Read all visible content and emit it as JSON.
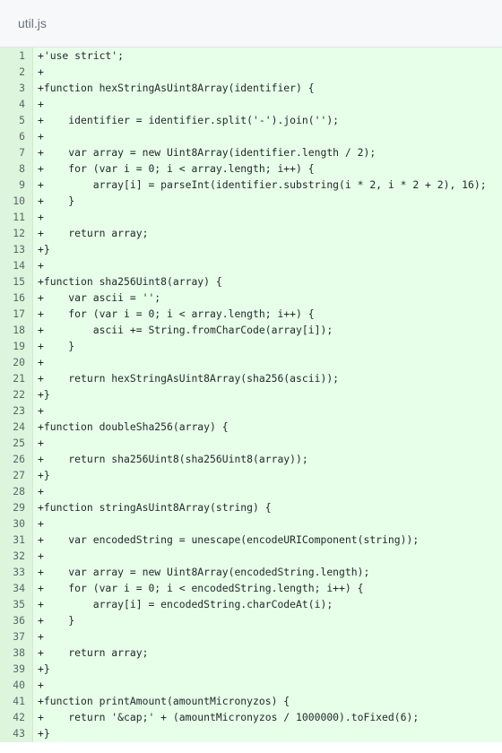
{
  "file": {
    "name": "util.js"
  },
  "diff": {
    "lines": [
      {
        "num": "1",
        "code": "+'use strict';"
      },
      {
        "num": "2",
        "code": "+"
      },
      {
        "num": "3",
        "code": "+function hexStringAsUint8Array(identifier) {"
      },
      {
        "num": "4",
        "code": "+"
      },
      {
        "num": "5",
        "code": "+    identifier = identifier.split('-').join('');"
      },
      {
        "num": "6",
        "code": "+"
      },
      {
        "num": "7",
        "code": "+    var array = new Uint8Array(identifier.length / 2);"
      },
      {
        "num": "8",
        "code": "+    for (var i = 0; i < array.length; i++) {"
      },
      {
        "num": "9",
        "code": "+        array[i] = parseInt(identifier.substring(i * 2, i * 2 + 2), 16);"
      },
      {
        "num": "10",
        "code": "+    }"
      },
      {
        "num": "11",
        "code": "+"
      },
      {
        "num": "12",
        "code": "+    return array;"
      },
      {
        "num": "13",
        "code": "+}"
      },
      {
        "num": "14",
        "code": "+"
      },
      {
        "num": "15",
        "code": "+function sha256Uint8(array) {"
      },
      {
        "num": "16",
        "code": "+    var ascii = '';"
      },
      {
        "num": "17",
        "code": "+    for (var i = 0; i < array.length; i++) {"
      },
      {
        "num": "18",
        "code": "+        ascii += String.fromCharCode(array[i]);"
      },
      {
        "num": "19",
        "code": "+    }"
      },
      {
        "num": "20",
        "code": "+"
      },
      {
        "num": "21",
        "code": "+    return hexStringAsUint8Array(sha256(ascii));"
      },
      {
        "num": "22",
        "code": "+}"
      },
      {
        "num": "23",
        "code": "+"
      },
      {
        "num": "24",
        "code": "+function doubleSha256(array) {"
      },
      {
        "num": "25",
        "code": "+"
      },
      {
        "num": "26",
        "code": "+    return sha256Uint8(sha256Uint8(array));"
      },
      {
        "num": "27",
        "code": "+}"
      },
      {
        "num": "28",
        "code": "+"
      },
      {
        "num": "29",
        "code": "+function stringAsUint8Array(string) {"
      },
      {
        "num": "30",
        "code": "+"
      },
      {
        "num": "31",
        "code": "+    var encodedString = unescape(encodeURIComponent(string));"
      },
      {
        "num": "32",
        "code": "+"
      },
      {
        "num": "33",
        "code": "+    var array = new Uint8Array(encodedString.length);"
      },
      {
        "num": "34",
        "code": "+    for (var i = 0; i < encodedString.length; i++) {"
      },
      {
        "num": "35",
        "code": "+        array[i] = encodedString.charCodeAt(i);"
      },
      {
        "num": "36",
        "code": "+    }"
      },
      {
        "num": "37",
        "code": "+"
      },
      {
        "num": "38",
        "code": "+    return array;"
      },
      {
        "num": "39",
        "code": "+}"
      },
      {
        "num": "40",
        "code": "+"
      },
      {
        "num": "41",
        "code": "+function printAmount(amountMicronyzos) {"
      },
      {
        "num": "42",
        "code": "+    return '&cap;' + (amountMicronyzos / 1000000).toFixed(6);"
      },
      {
        "num": "43",
        "code": "+}"
      }
    ]
  }
}
